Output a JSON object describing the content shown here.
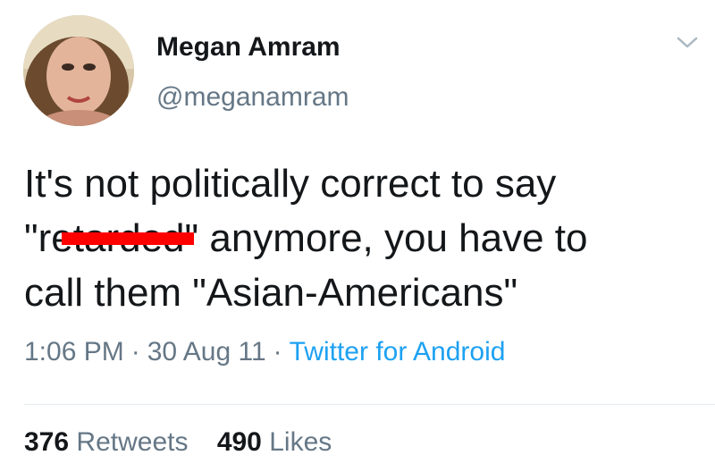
{
  "author": {
    "display_name": "Megan Amram",
    "handle": "@meganamram"
  },
  "icons": {
    "more": "chevron-down-icon",
    "avatar": "profile-photo"
  },
  "tweet": {
    "line1": "It's not politically correct to say",
    "line2_open": "\"r",
    "line2_censored": "etarde",
    "line2_rest": "d\" anymore, you have to",
    "line3": "call them \"Asian-Americans\""
  },
  "meta": {
    "time": "1:06 PM",
    "separator": "·",
    "date": "30 Aug 11",
    "source": "Twitter for Android"
  },
  "stats": {
    "retweets_count": "376",
    "retweets_label": "Retweets",
    "likes_count": "490",
    "likes_label": "Likes"
  },
  "colors": {
    "text": "#14171a",
    "secondary": "#657786",
    "link": "#1da1f2",
    "censor": "#ff0000"
  }
}
